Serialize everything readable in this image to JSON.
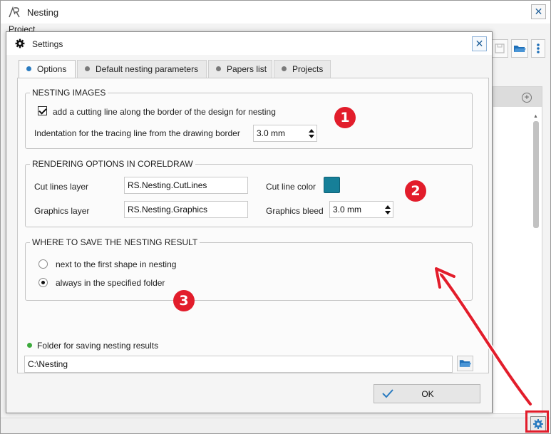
{
  "app": {
    "title": "Nesting",
    "menu_project": "Project"
  },
  "dialog": {
    "title": "Settings",
    "close_glyph": "✕",
    "tabs": [
      {
        "label": "Options",
        "active": true
      },
      {
        "label": "Default nesting parameters",
        "active": false
      },
      {
        "label": "Papers list",
        "active": false
      },
      {
        "label": "Projects",
        "active": false
      }
    ],
    "nesting_images": {
      "title": "NESTING IMAGES",
      "cutting_line_label": "add a cutting line along the border of the design for nesting",
      "cutting_line_checked": true,
      "indentation_label": "Indentation for the tracing line from the drawing border",
      "indentation_value": "3.0 mm"
    },
    "rendering": {
      "title": "RENDERING OPTIONS IN CORELDRAW",
      "cut_lines_layer_label": "Cut lines layer",
      "cut_lines_layer_value": "RS.Nesting.CutLines",
      "graphics_layer_label": "Graphics layer",
      "graphics_layer_value": "RS.Nesting.Graphics",
      "cut_line_color_label": "Cut line color",
      "cut_line_color": "#167f98",
      "graphics_bleed_label": "Graphics bleed",
      "graphics_bleed_value": "3.0 mm"
    },
    "save_location": {
      "title": "WHERE TO SAVE THE NESTING RESULT",
      "option_next_to_shape": "next to the first shape in nesting",
      "option_specified_folder": "always in the specified folder",
      "selected": "always in the specified folder"
    },
    "folder": {
      "label": "Folder for saving nesting results",
      "value": "C:\\Nesting"
    },
    "ok_label": "OK"
  },
  "annotations": {
    "badge_1": "1",
    "badge_2": "2",
    "badge_3": "3",
    "color": "#e21d2b"
  },
  "icons": [
    "nesting-logo-icon",
    "gear-icon",
    "close-icon",
    "folder-open-icon",
    "checkmark-icon",
    "plus-circle-icon",
    "save-icon",
    "more-vertical-icon"
  ]
}
